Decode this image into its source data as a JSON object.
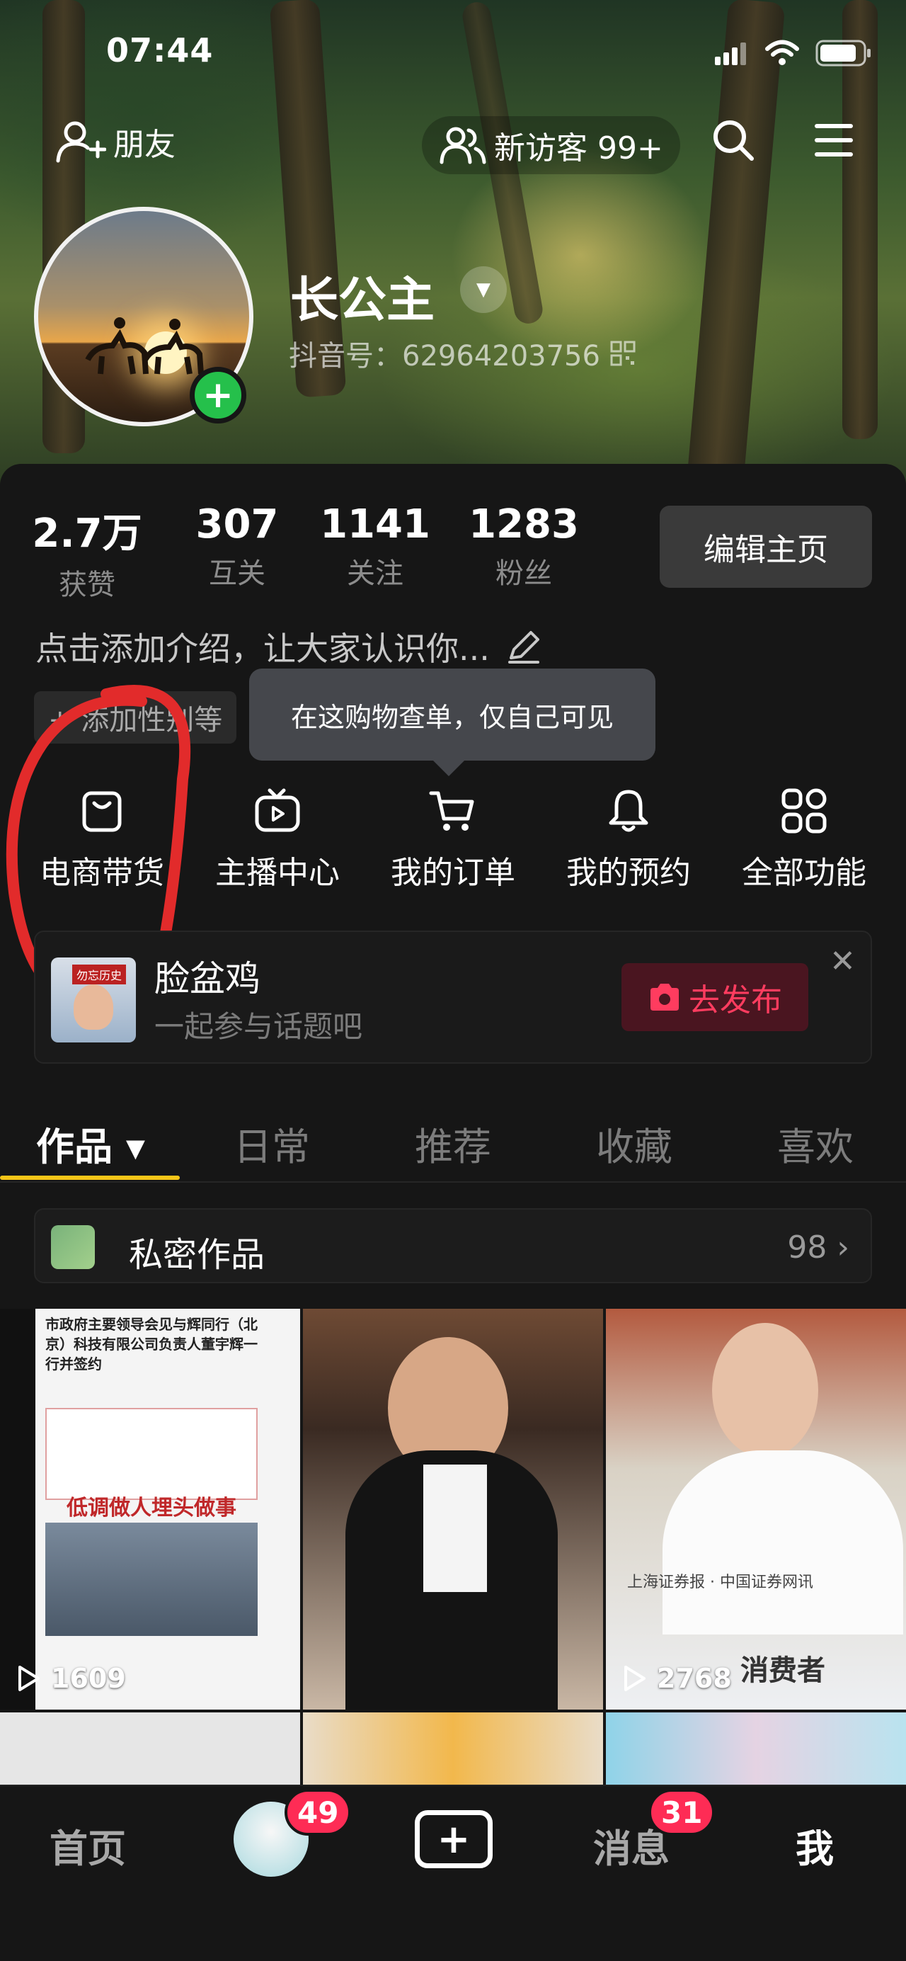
{
  "status_bar": {
    "time": "07:44"
  },
  "top_nav": {
    "friends_label": "朋友",
    "new_visitors_label": "新访客 99+"
  },
  "profile": {
    "nickname": "长公主",
    "douyin_id": "抖音号：62964203756"
  },
  "stats": [
    {
      "value": "2.7万",
      "label": "获赞"
    },
    {
      "value": "307",
      "label": "互关"
    },
    {
      "value": "1141",
      "label": "关注"
    },
    {
      "value": "1283",
      "label": "粉丝"
    }
  ],
  "edit_profile_label": "编辑主页",
  "bio_placeholder": "点击添加介绍，让大家认识你...",
  "tag_chip": "+ 添加性别等",
  "tooltip_text": "在这购物查单，仅自己可见",
  "functions": [
    {
      "label": "电商带货",
      "icon": "shopping-bag-icon"
    },
    {
      "label": "主播中心",
      "icon": "tv-play-icon"
    },
    {
      "label": "我的订单",
      "icon": "cart-icon"
    },
    {
      "label": "我的预约",
      "icon": "bell-icon"
    },
    {
      "label": "全部功能",
      "icon": "grid-icon"
    }
  ],
  "topic_card": {
    "title": "脸盆鸡",
    "subtitle": "一起参与话题吧",
    "publish_label": "去发布",
    "thumb_caption": "勿忘历史"
  },
  "tabs": [
    {
      "label": "作品 ▾",
      "active": true
    },
    {
      "label": "日常",
      "active": false
    },
    {
      "label": "推荐",
      "active": false
    },
    {
      "label": "收藏",
      "active": false
    },
    {
      "label": "喜欢",
      "active": false
    }
  ],
  "private_works": {
    "label": "私密作品",
    "count": "98 ›"
  },
  "videos": [
    {
      "play_count": "1609",
      "headline": "市政府主要领导会见与辉同行（北京）科技有限公司负责人董宇辉一行并签约",
      "banner": "低调做人埋头做事"
    },
    {
      "play_count": ""
    },
    {
      "play_count": "2768",
      "caption": "上海证券报 · 中国证券网讯",
      "subtitle": "消费者"
    }
  ],
  "bottom_nav": {
    "home": "首页",
    "friends_badge": "49",
    "messages": "消息",
    "messages_badge": "31",
    "me": "我"
  },
  "colors": {
    "accent_yellow": "#f5c518",
    "badge_red": "#fe2c55",
    "publish_red": "#ff3c5f",
    "follow_green": "#25c04b"
  }
}
